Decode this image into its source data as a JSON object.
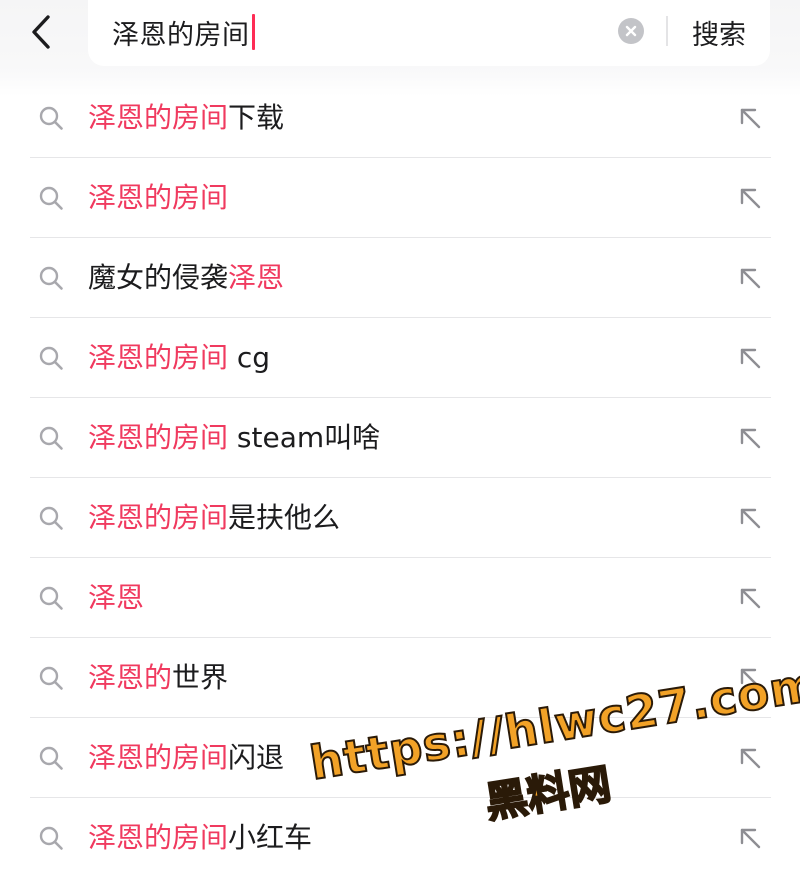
{
  "search": {
    "query": "泽恩的房间",
    "submit_label": "搜索"
  },
  "suggestions": [
    {
      "highlight": "泽恩的房间",
      "rest": "下载",
      "order": "hl-first"
    },
    {
      "highlight": "泽恩的房间",
      "rest": "",
      "order": "hl-first"
    },
    {
      "highlight": "泽恩",
      "rest": "魔女的侵袭",
      "order": "rest-first"
    },
    {
      "highlight": "泽恩的房间",
      "rest": " cg",
      "order": "hl-first"
    },
    {
      "highlight": "泽恩的房间",
      "rest": " steam叫啥",
      "order": "hl-first"
    },
    {
      "highlight": "泽恩的房间",
      "rest": "是扶他么",
      "order": "hl-first"
    },
    {
      "highlight": "泽恩",
      "rest": "",
      "order": "hl-first"
    },
    {
      "highlight": "泽恩的",
      "rest": "世界",
      "order": "hl-first"
    },
    {
      "highlight": "泽恩的房间",
      "rest": "闪退",
      "order": "hl-first"
    },
    {
      "highlight": "泽恩的房间",
      "rest": "小红车",
      "order": "hl-first"
    }
  ],
  "icons": {
    "back": "chevron-left-icon",
    "clear": "clear-circle-icon",
    "suggestion": "search-icon",
    "fill": "arrow-up-left-icon"
  },
  "colors": {
    "highlight": "#f03a5f",
    "caret": "#fe2c55",
    "watermark": "#f2a227"
  },
  "watermark": {
    "url": "https://hlwc27.com",
    "label": "黑料网"
  }
}
